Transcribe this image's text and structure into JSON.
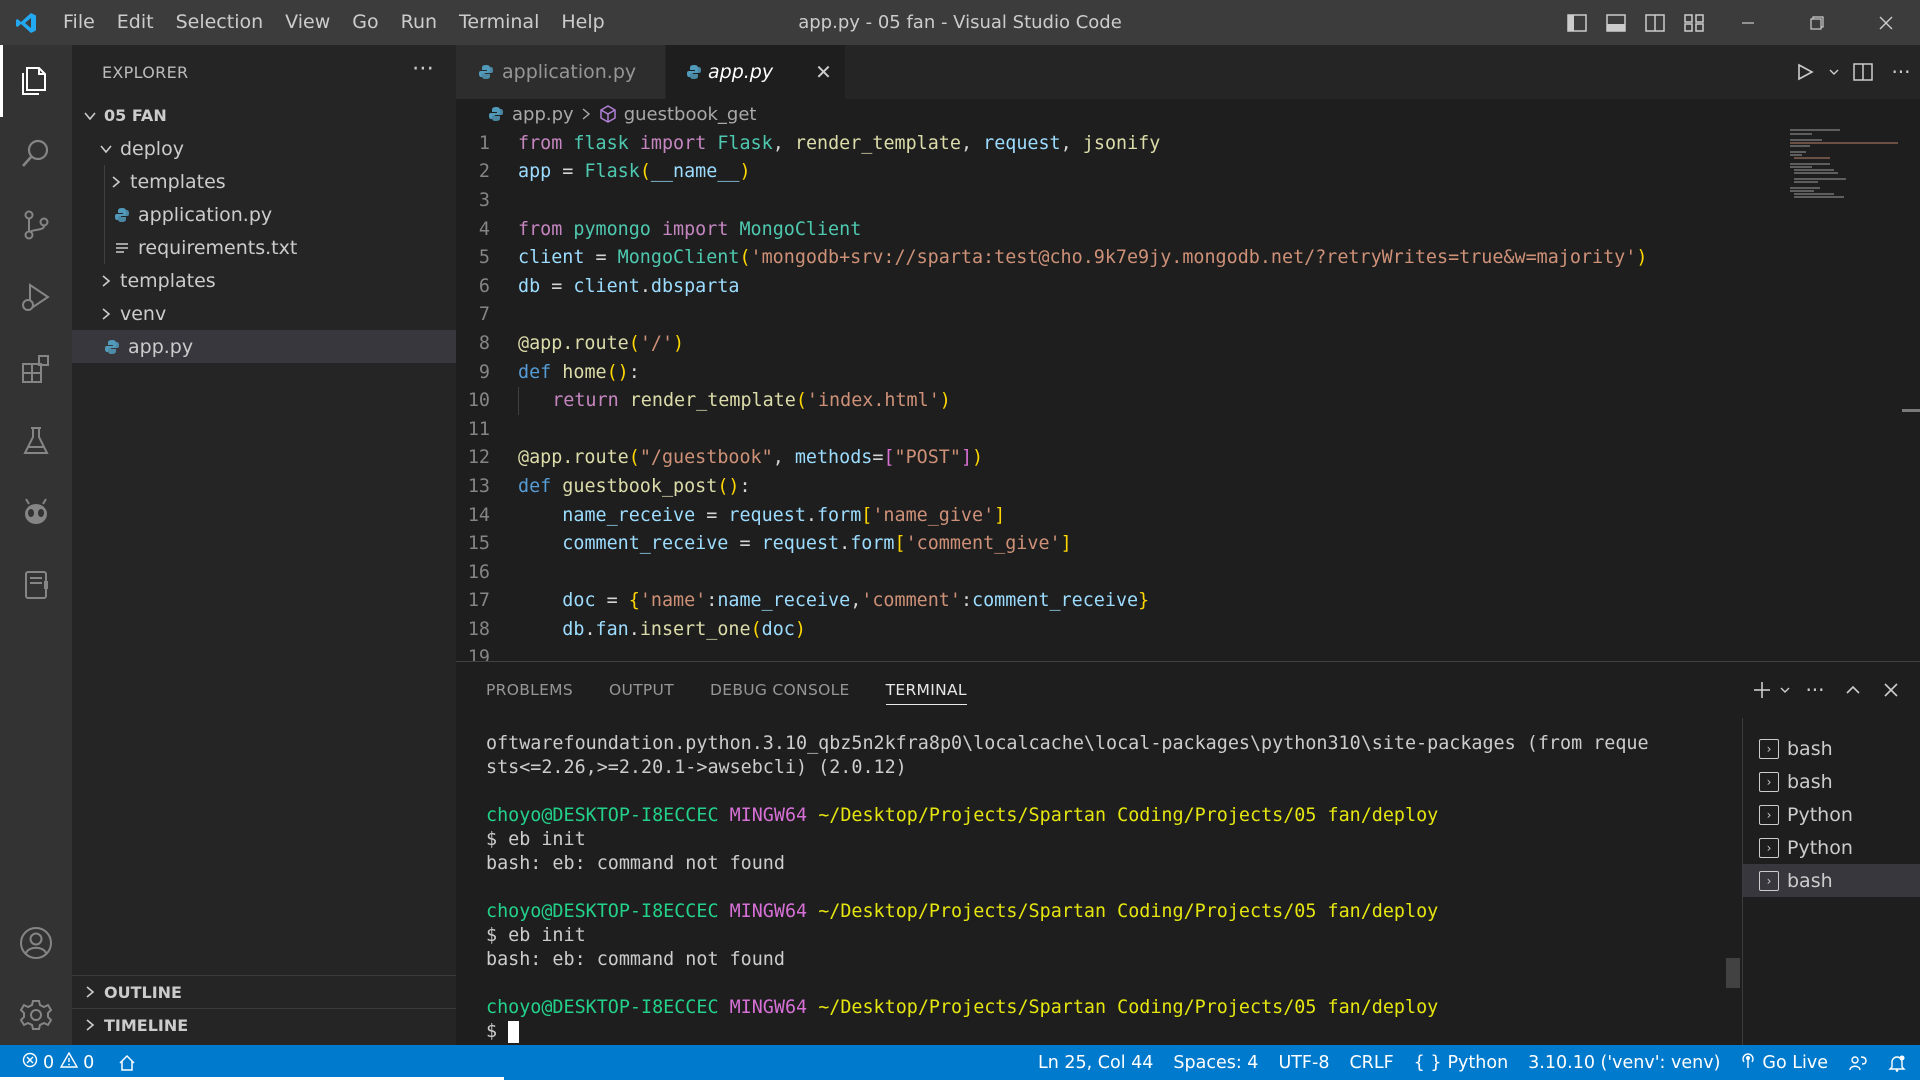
{
  "window": {
    "title": "app.py - 05 fan - Visual Studio Code",
    "menu": [
      "File",
      "Edit",
      "Selection",
      "View",
      "Go",
      "Run",
      "Terminal",
      "Help"
    ]
  },
  "sidebar": {
    "header": "EXPLORER",
    "root": "05 FAN",
    "tree": [
      {
        "label": "deploy",
        "kind": "folder-open",
        "depth": 1
      },
      {
        "label": "templates",
        "kind": "folder",
        "depth": 2
      },
      {
        "label": "application.py",
        "kind": "python",
        "depth": 2
      },
      {
        "label": "requirements.txt",
        "kind": "text",
        "depth": 2
      },
      {
        "label": "templates",
        "kind": "folder",
        "depth": 1
      },
      {
        "label": "venv",
        "kind": "folder",
        "depth": 1
      },
      {
        "label": "app.py",
        "kind": "python",
        "depth": 1,
        "selected": true
      }
    ],
    "outline": "OUTLINE",
    "timeline": "TIMELINE"
  },
  "tabs": [
    {
      "label": "application.py",
      "active": false
    },
    {
      "label": "app.py",
      "active": true
    }
  ],
  "breadcrumb": {
    "file": "app.py",
    "symbol": "guestbook_get"
  },
  "code_lines": [
    "from flask import Flask, render_template, request, jsonify",
    "app = Flask(__name__)",
    "",
    "from pymongo import MongoClient",
    "client = MongoClient('mongodb+srv://sparta:test@cho.9k7e9jy.mongodb.net/?retryWrites=true&w=majority')",
    "db = client.dbsparta",
    "",
    "@app.route('/')",
    "def home():",
    "    return render_template('index.html')",
    "",
    "@app.route(\"/guestbook\", methods=[\"POST\"])",
    "def guestbook_post():",
    "    name_receive = request.form['name_give']",
    "    comment_receive = request.form['comment_give']",
    "",
    "    doc = {'name':name_receive,'comment':comment_receive}",
    "    db.fan.insert_one(doc)",
    ""
  ],
  "panel": {
    "tabs": [
      "PROBLEMS",
      "OUTPUT",
      "DEBUG CONSOLE",
      "TERMINAL"
    ],
    "active_tab": "TERMINAL",
    "terminal": {
      "out1": "oftwarefoundation.python.3.10_qbz5n2kfra8p0\\localcache\\local-packages\\python310\\site-packages (from reque",
      "out2": "sts<=2.26,>=2.20.1->awsebcli) (2.0.12)",
      "user": "choyo@DESKTOP-I8ECCEC",
      "shell": "MINGW64",
      "path": "~/Desktop/Projects/Spartan Coding/Projects/05 fan/deploy",
      "cmd": "$ eb init",
      "error": "bash: eb: command not found",
      "prompt": "$ "
    },
    "terminals": [
      {
        "label": "bash",
        "selected": false
      },
      {
        "label": "bash",
        "selected": false
      },
      {
        "label": "Python",
        "selected": false
      },
      {
        "label": "Python",
        "selected": false
      },
      {
        "label": "bash",
        "selected": true
      }
    ]
  },
  "status": {
    "errors": "0",
    "warnings": "0",
    "position": "Ln 25, Col 44",
    "spaces": "Spaces: 4",
    "encoding": "UTF-8",
    "eol": "CRLF",
    "language": "Python",
    "interpreter": "3.10.10 ('venv': venv)",
    "golive": "Go Live"
  },
  "colors": {
    "accent": "#007acc",
    "titlebar": "#3c3c3c",
    "activitybar": "#333333",
    "sidebar": "#252526",
    "editor": "#1e1e1e"
  }
}
